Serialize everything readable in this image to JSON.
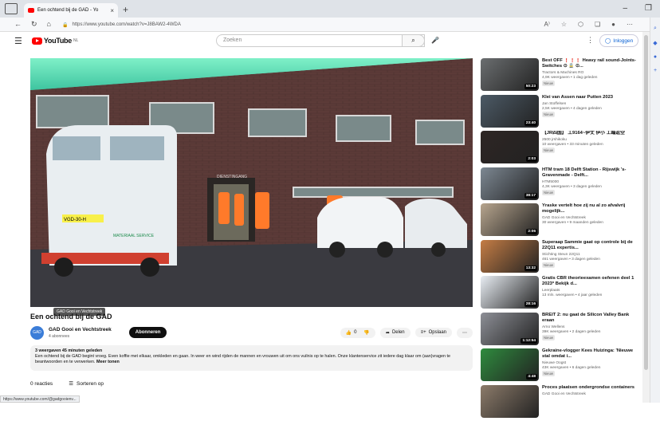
{
  "browser": {
    "tab_title": "Een ochtend bij de GAD - Yo",
    "url": "https://www.youtube.com/watch?v=J8BAW2-4WDA",
    "status_url": "https://www.youtube.com/@gadgooienv..."
  },
  "header": {
    "logo_text": "YouTube",
    "logo_region": "NL",
    "search_placeholder": "Zoeken",
    "signin_label": "Inloggen"
  },
  "video": {
    "title": "Een ochtend bij de GAD",
    "tooltip": "GAD Gooi en Vechtstreek",
    "channel": "GAD Gooi en Vechtstreek",
    "subscribers": "4 abonnees",
    "subscribe_label": "Abonneren",
    "like_count": "0",
    "share_label": "Delen",
    "save_label": "Opslaan",
    "desc_meta": "3 weergaven  45 minuten geleden",
    "desc_text": "Een ochtend bij de GAD begint vroeg. Even koffie met elkaar, omkleden en gaan. In weer en wind rijden de mannen en vrouwen uit om ons vuilnis op te halen. Onze klantenservice zit iedere dag klaar om (aan)vragen te beantwoorden en te verwerken.",
    "show_more": "Meer tonen",
    "comments_count": "0 reacties",
    "sort_label": "Sorteren op",
    "van_plate": "VGD-30-H",
    "van_brand": "MATERIAAL SERVICE",
    "sign_text": "DIENSTINGANG"
  },
  "recommendations": [
    {
      "title": "Best OFF ❗❗❗ Heavy rail sound-Joints-Switches ⊙ 🚊 ⊙...",
      "channel": "Tractors & Machines RO",
      "meta": "4,9K weergaven • 1 dag geleden",
      "badge": "Nieuw",
      "duration": "50:23",
      "color": "#6b6e70"
    },
    {
      "title": "Klei van Assen naar Putten 2023",
      "channel": "Jan Stoffelsen",
      "meta": "2,5K weergaven • 4 dagen geleden",
      "badge": "Nieuw",
      "duration": "23:40",
      "color": "#4c5a66"
    },
    {
      "title": "【JR四国】 工9164~伊丈 伊小 工臨返空",
      "channel": "2500 jrshikoku",
      "meta": "10 weergaven • 33 minuten geleden",
      "badge": "Nieuw",
      "duration": "2:03",
      "color": "#2e2624"
    },
    {
      "title": "HTM tram 18 Delft Station - Rijswijk 's-Gravenmade - Delft...",
      "channel": "HTM5000",
      "meta": "4,3K weergaven • 3 dagen geleden",
      "badge": "Nieuw",
      "duration": "38:17",
      "color": "#7d8893"
    },
    {
      "title": "Yraske vertelt hoe zij nu al zo afvalvrij mogelijk...",
      "channel": "GAD Gooi en Vechtstreek",
      "meta": "30 weergaven • 9 maanden geleden",
      "badge": "",
      "duration": "2:06",
      "color": "#b7a58e"
    },
    {
      "title": "Superaap Sammie gaat op controle bij de 22Q11 expertis...",
      "channel": "Stichting Steun 22Q11",
      "meta": "461 weergaven • 3 dagen geleden",
      "badge": "Nieuw",
      "duration": "13:32",
      "color": "#c57d45"
    },
    {
      "title": "Gratis CBR theorieexamen oefenen deel 1 2023* Bekijk d...",
      "channel": "Leerplaats",
      "meta": "13 mln. weergaven • 4 jaar geleden",
      "badge": "",
      "duration": "28:16",
      "color": "#e9eef4"
    },
    {
      "title": "BREIT 2: nu gaat de Silicon Valley Bank eraan",
      "channel": "Arno Wellens",
      "meta": "39K weergaven • 2 dagen geleden",
      "badge": "Nieuw",
      "duration": "1:12:54",
      "color": "#8d8f96"
    },
    {
      "title": "Gekraine-vlogger Kees Huizinga: 'Nieuwe stal omdat i...",
      "channel": "Nieuwe Oogst",
      "meta": "43K weergaven • 6 dagen geleden",
      "badge": "Nieuw",
      "duration": "4:48",
      "color": "#2f8b3e"
    },
    {
      "title": "Proces plaatsen ondergrondse containers",
      "channel": "GAD Gooi en Vechtstreek",
      "meta": "",
      "badge": "",
      "duration": "",
      "color": "#8c7b6a"
    }
  ]
}
